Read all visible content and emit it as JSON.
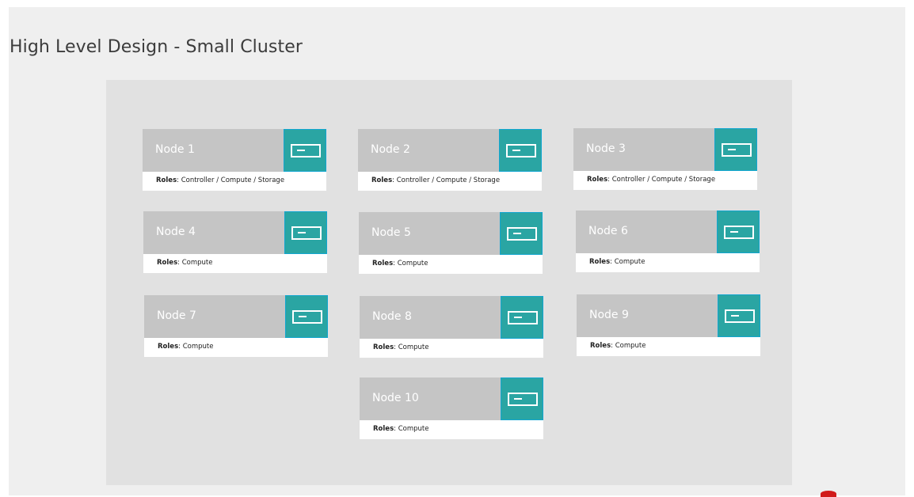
{
  "title": "High Level Design - Small Cluster",
  "roles_label": "Roles",
  "nodes": [
    {
      "name": "Node 1",
      "roles": ": Controller / Compute / Storage"
    },
    {
      "name": "Node 2",
      "roles": ": Controller / Compute / Storage"
    },
    {
      "name": "Node 3",
      "roles": ": Controller / Compute / Storage"
    },
    {
      "name": "Node 4",
      "roles": ": Compute"
    },
    {
      "name": "Node 5",
      "roles": ": Compute"
    },
    {
      "name": "Node 6",
      "roles": ": Compute"
    },
    {
      "name": "Node 7",
      "roles": ": Compute"
    },
    {
      "name": "Node 8",
      "roles": ": Compute"
    },
    {
      "name": "Node 9",
      "roles": ": Compute"
    },
    {
      "name": "Node 10",
      "roles": ": Compute"
    }
  ],
  "colors": {
    "background": "#efefef",
    "panel": "#e1e1e1",
    "node_header": "#c5c5c5",
    "server_tile": "#2aa5a3",
    "server_border": "#12a6cf",
    "logo_mark": "#d11a1a"
  },
  "icons": {
    "server": "server-icon"
  }
}
